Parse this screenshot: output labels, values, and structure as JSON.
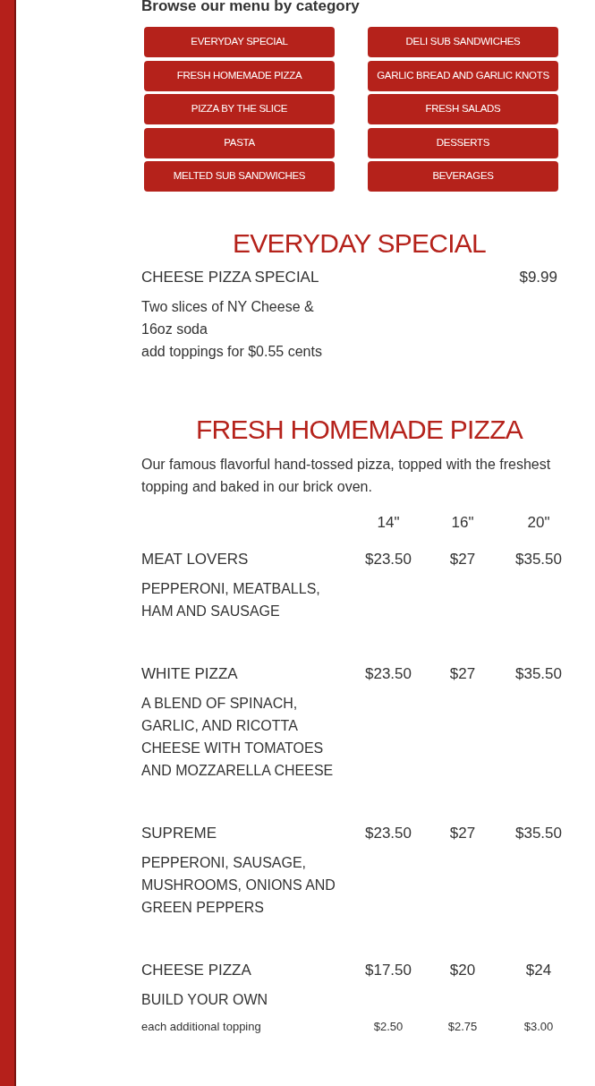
{
  "browse_heading": "Browse our menu by category",
  "categories": [
    {
      "label": "EVERYDAY SPECIAL"
    },
    {
      "label": "DELI SUB SANDWICHES"
    },
    {
      "label": "FRESH HOMEMADE PIZZA"
    },
    {
      "label": "GARLIC BREAD AND GARLIC KNOTS"
    },
    {
      "label": "PIZZA BY THE SLICE"
    },
    {
      "label": "FRESH SALADS"
    },
    {
      "label": "PASTA"
    },
    {
      "label": "DESSERTS"
    },
    {
      "label": "MELTED SUB SANDWICHES"
    },
    {
      "label": "BEVERAGES"
    }
  ],
  "everyday_special": {
    "title": "EVERYDAY SPECIAL",
    "item": {
      "name": "CHEESE PIZZA SPECIAL",
      "price": "$9.99",
      "description": [
        "Two slices of NY Cheese & 16oz soda",
        "add toppings for $0.55 cents"
      ]
    }
  },
  "fresh_homemade_pizza": {
    "title": "FRESH HOMEMADE PIZZA",
    "intro": "Our famous flavorful hand-tossed pizza, topped with the freshest topping and baked in our brick oven.",
    "sizes": [
      "14\"",
      "16\"",
      "20\""
    ],
    "items": [
      {
        "name": "MEAT LOVERS",
        "prices": [
          "$23.50",
          "$27",
          "$35.50"
        ],
        "description": "PEPPERONI, MEATBALLS, HAM AND SAUSAGE"
      },
      {
        "name": "WHITE PIZZA",
        "prices": [
          "$23.50",
          "$27",
          "$35.50"
        ],
        "description": "A BLEND OF SPINACH, GARLIC, AND RICOTTA CHEESE WITH TOMATOES AND MOZZARELLA CHEESE"
      },
      {
        "name": "SUPREME",
        "prices": [
          "$23.50",
          "$27",
          "$35.50"
        ],
        "description": "PEPPERONI, SAUSAGE, MUSHROOMS, ONIONS AND GREEN PEPPERS"
      },
      {
        "name": "CHEESE PIZZA",
        "prices": [
          "$17.50",
          "$20",
          "$24"
        ],
        "description": "BUILD YOUR OWN",
        "extra": {
          "label": "each additional topping",
          "prices": [
            "$2.50",
            "$2.75",
            "$3.00"
          ]
        }
      }
    ]
  }
}
